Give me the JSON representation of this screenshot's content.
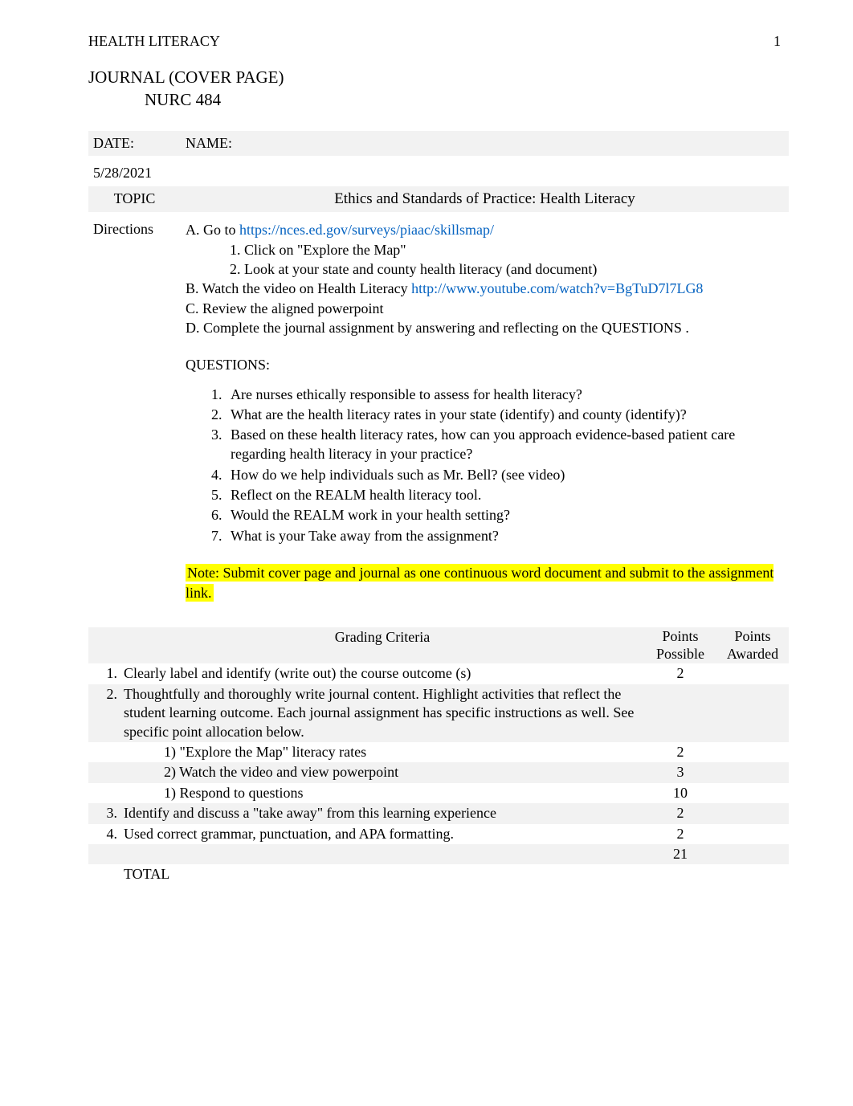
{
  "header": {
    "running_head": "HEALTH LITERACY",
    "page_number": "1"
  },
  "title": {
    "line1": "JOURNAL   (COVER PAGE)",
    "line2": "NURC 484"
  },
  "meta": {
    "date_label": "DATE:",
    "date_value": "5/28/2021",
    "name_label": "NAME:",
    "topic_label": "TOPIC",
    "topic_value": "Ethics and Standards of Practice: Health Literacy",
    "directions_label": "Directions"
  },
  "directions": {
    "a_prefix": "A. Go to  ",
    "a_link": "https://nces.ed.gov/surveys/piaac/skillsmap/",
    "a_sub1": "1. Click on \"Explore the Map\"",
    "a_sub2": "2. Look at your state and county health literacy (and document)",
    "b_prefix": "B. Watch the video on Health Literacy  ",
    "b_link": "http://www.youtube.com/watch?v=BgTuD7l7LG8",
    "c": "C. Review the aligned powerpoint",
    "d": "D. Complete the journal assignment by answering and reflecting on the QUESTIONS .",
    "questions_header": "QUESTIONS:",
    "questions": [
      "Are nurses ethically responsible to assess for health literacy?",
      "What are the health literacy rates in your state (identify) and county (identify)?",
      "Based on these health literacy rates, how can you approach evidence-based patient care regarding health literacy in your practice?",
      "How do we help individuals such as Mr. Bell? (see video)",
      "Reflect on the REALM health literacy tool.",
      "Would the REALM work in your health setting?",
      "What is your Take away from the assignment?"
    ],
    "note": "Note: Submit cover page and journal as one continuous word document and submit to the assignment link."
  },
  "grading": {
    "title": "Grading Criteria",
    "col_possible_line1": "Points",
    "col_possible_line2": "Possible",
    "col_awarded_line1": "Points",
    "col_awarded_line2": "Awarded",
    "rows": [
      {
        "num": "1.",
        "text": "Clearly label and identify (write out) the course outcome (s)",
        "points": "2"
      },
      {
        "num": "2.",
        "text": "Thoughtfully and thoroughly write journal content. Highlight activities that reflect the student learning outcome. Each journal assignment has specific instructions as well.  See specific point allocation below.",
        "points": ""
      },
      {
        "num": "",
        "text": "1)  \"Explore the Map\" literacy rates",
        "points": "2",
        "sub": true
      },
      {
        "num": "",
        "text": "2)  Watch the video and view powerpoint",
        "points": "3",
        "sub": true
      },
      {
        "num": "",
        "text": "1)  Respond to questions",
        "points": "10",
        "sub": true
      },
      {
        "num": "3.",
        "text": "Identify and discuss a \"take away\" from this learning experience",
        "points": "2"
      },
      {
        "num": "4.",
        "text": "Used correct grammar, punctuation, and APA formatting.",
        "points": "2"
      },
      {
        "num": "",
        "text": "",
        "points": "21"
      },
      {
        "num": "",
        "text": "TOTAL",
        "points": ""
      }
    ]
  }
}
